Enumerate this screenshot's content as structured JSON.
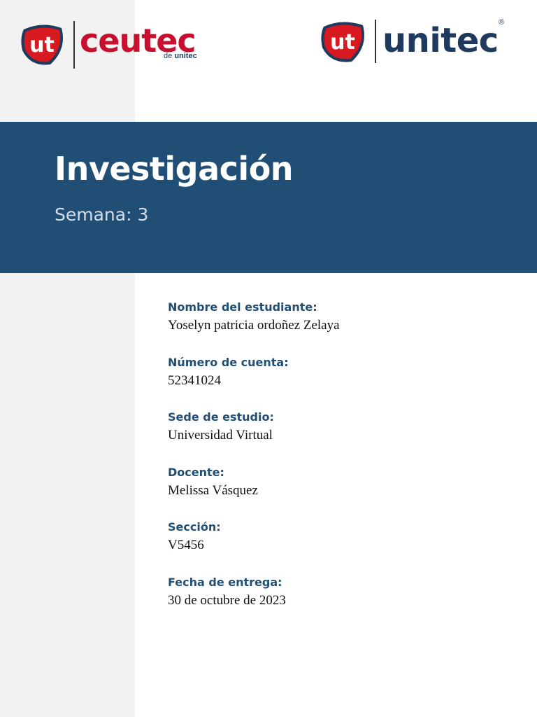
{
  "logos": {
    "ceutec": {
      "badge_text": "ut",
      "wordmark_light": "ceu",
      "wordmark_dark": "tec",
      "sub_prefix": "de",
      "sub_brand": "unitec"
    },
    "unitec": {
      "badge_text": "ut",
      "wordmark": "unitec",
      "registered": "®"
    }
  },
  "colors": {
    "banner": "#204e75",
    "brand_red": "#c8102e",
    "brand_navy": "#1f3a5f",
    "sidebar": "#f2f2f2"
  },
  "banner": {
    "title": "Investigación",
    "subtitle": "Semana: 3"
  },
  "fields": [
    {
      "label": "Nombre del estudiante:",
      "value": "Yoselyn patricia ordoñez Zelaya"
    },
    {
      "label": "Número de cuenta:",
      "value": "52341024"
    },
    {
      "label": "Sede de estudio:",
      "value": "Universidad Virtual"
    },
    {
      "label": "Docente:",
      "value": "Melissa Vásquez"
    },
    {
      "label": "Sección:",
      "value": "V5456"
    },
    {
      "label": "Fecha de entrega:",
      "value": "30 de octubre de 2023"
    }
  ]
}
